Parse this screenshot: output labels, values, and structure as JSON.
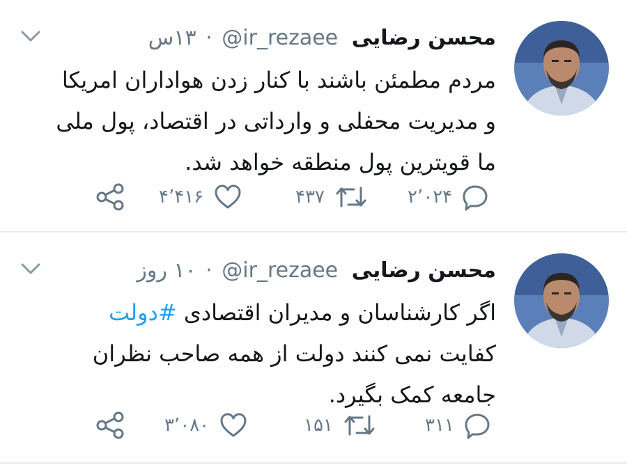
{
  "tweets": [
    {
      "name": "محسن رضایی",
      "handle": "@ir_rezaee",
      "separator": "·",
      "time": "۱۳س",
      "text": "مردم مطمئن باشند با کنار زدن هواداران امریکا و مدیریت محفلی و وارداتی در اقتصاد، پول ملی ما قویترین پول منطقه خواهد شد.",
      "hashtag": "",
      "replies": "۲٬۰۲۴",
      "retweets": "۴۳۷",
      "likes": "۴٬۴۱۶"
    },
    {
      "name": "محسن رضایی",
      "handle": "@ir_rezaee",
      "separator": "·",
      "time": "۱۰ روز",
      "text_before": "اگر کارشناسان و مدیران اقتصادی ",
      "hashtag": "#دولت",
      "text_after": " کفایت نمی کنند دولت از همه صاحب نظران جامعه کمک بگیرد.",
      "replies": "۳۱۱",
      "retweets": "۱۵۱",
      "likes": "۳٬۰۸۰"
    }
  ],
  "icons": {
    "reply": "reply-icon",
    "retweet": "retweet-icon",
    "like": "heart-icon",
    "share": "share-icon",
    "menu": "chevron-down-icon"
  },
  "colors": {
    "text": "#14171a",
    "secondary": "#657786",
    "link": "#1da1f2",
    "divider": "#e6ecf0"
  }
}
